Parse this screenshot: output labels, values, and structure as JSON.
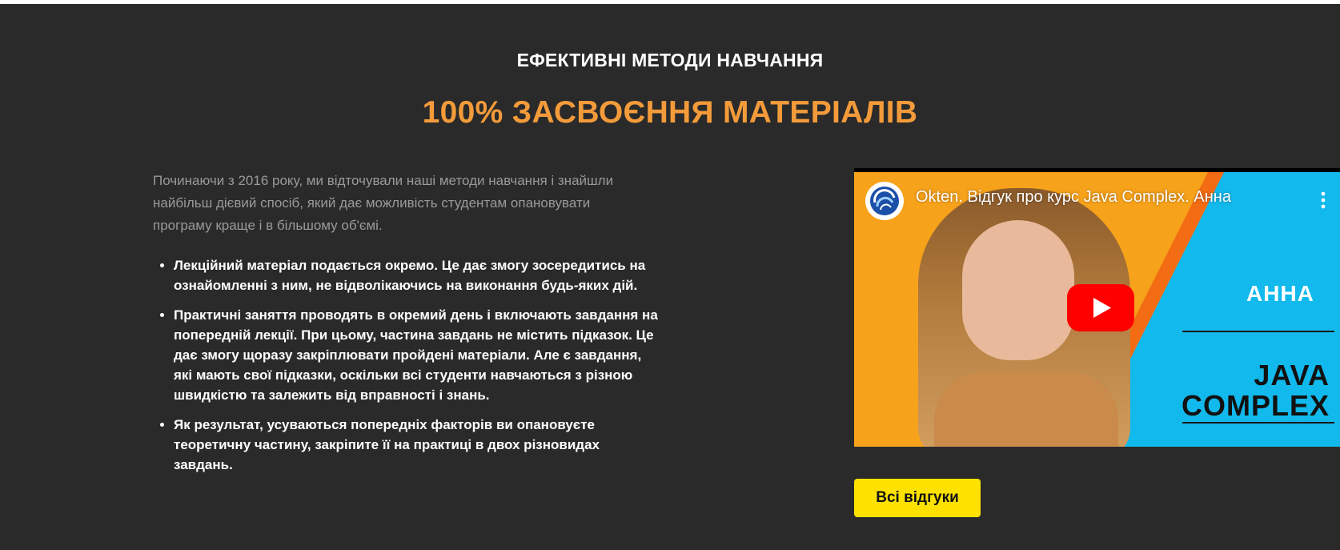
{
  "section": {
    "kicker": "ЕФЕКТИВНІ МЕТОДИ НАВЧАННЯ",
    "headline": "100% ЗАСВОЄННЯ МАТЕРІАЛІВ",
    "intro": "Починаючи з 2016 року, ми відточували наші методи навчання і знайшли найбільш дієвий спосіб, який дає можливість студентам опановувати програму краще і в більшому об'ємі.",
    "bullets": [
      "Лекційний матеріал подається окремо. Це дає змогу зосередитись на ознайомленні з ним, не відволікаючись на виконання будь-яких дій.",
      "Практичні заняття проводять в окремий день і включають завдання на попередній лекції. При цьому, частина завдань не містить підказок. Це дає змогу щоразу закріплювати пройдені матеріали. Але є завдання, які мають свої підказки, оскільки всі студенти навчаються з різною швидкістю та залежить від вправності і знань.",
      "Як результат, усуваються попередніх факторів ви опановуєте теоретичну частину, закріпите її на практиці в двох різновидах завдань."
    ]
  },
  "video": {
    "title": "Okten. Відгук про курс Java Complex. Анна",
    "thumbnail_name": "АННА",
    "thumbnail_course_line1": "JAVA",
    "thumbnail_course_line2": "COMPLEX",
    "channel_icon": "okten-logo-icon",
    "menu_icon": "more-vert-icon",
    "play_icon": "youtube-play-icon"
  },
  "reviews_button": {
    "label": "Всі відгуки"
  },
  "colors": {
    "background": "#2a2a2a",
    "headline": "#f39b3a",
    "intro_text": "#9a9a9a",
    "button": "#ffe100",
    "youtube_red": "#ff0000"
  }
}
